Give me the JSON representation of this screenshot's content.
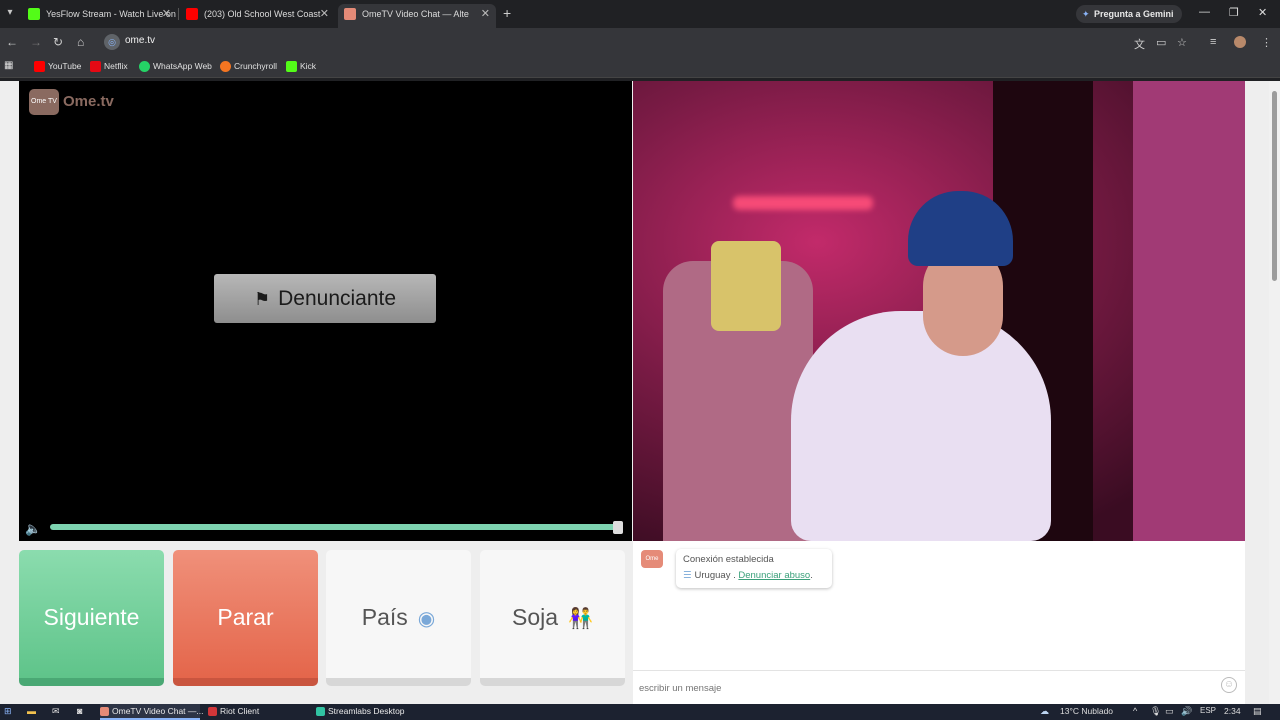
{
  "browser": {
    "tabs": [
      {
        "label": "YesFlow Stream - Watch Live on",
        "icon": "kick-icon",
        "color": "#53fc18"
      },
      {
        "label": "(203) Old School West Coast",
        "icon": "youtube-icon",
        "color": "#ff0000"
      },
      {
        "label": "OmeTV Video Chat — Alte",
        "icon": "ometv-icon",
        "color": "#e58b78"
      }
    ],
    "gemini_label": "Pregunta a Gemini",
    "url": "ome.tv",
    "bookmarks": [
      {
        "label": "YouTube",
        "color": "#ff0000"
      },
      {
        "label": "Netflix",
        "color": "#e50914"
      },
      {
        "label": "WhatsApp Web",
        "color": "#25d366"
      },
      {
        "label": "Crunchyroll",
        "color": "#f47521"
      },
      {
        "label": "Kick",
        "color": "#53fc18"
      }
    ]
  },
  "app": {
    "logo_text": "Ome.tv",
    "logo_badge": "Ome TV",
    "report_button": "Denunciante",
    "volume_level": 1.0,
    "buttons": {
      "next": "Siguiente",
      "stop": "Parar",
      "country": "País",
      "gender": "Soja"
    },
    "chat": {
      "status": "Conexión establecida",
      "country": "Uruguay",
      "separator": ".",
      "report_link": "Denunciar abuso",
      "report_link_suffix": ".",
      "input_placeholder": "escribir un mensaje"
    }
  },
  "taskbar": {
    "items": [
      {
        "label": "OmeTV Video Chat —...",
        "color": "#e58b78"
      },
      {
        "label": "Riot Client",
        "color": "#d13639"
      },
      {
        "label": "Streamlabs Desktop",
        "color": "#31c3a2"
      }
    ],
    "weather": "13°C  Nublado",
    "language": "ESP",
    "time": "2:34"
  },
  "colors": {
    "next": "#6cca94",
    "stop": "#e8735a",
    "volume": "#7dd3b0"
  }
}
